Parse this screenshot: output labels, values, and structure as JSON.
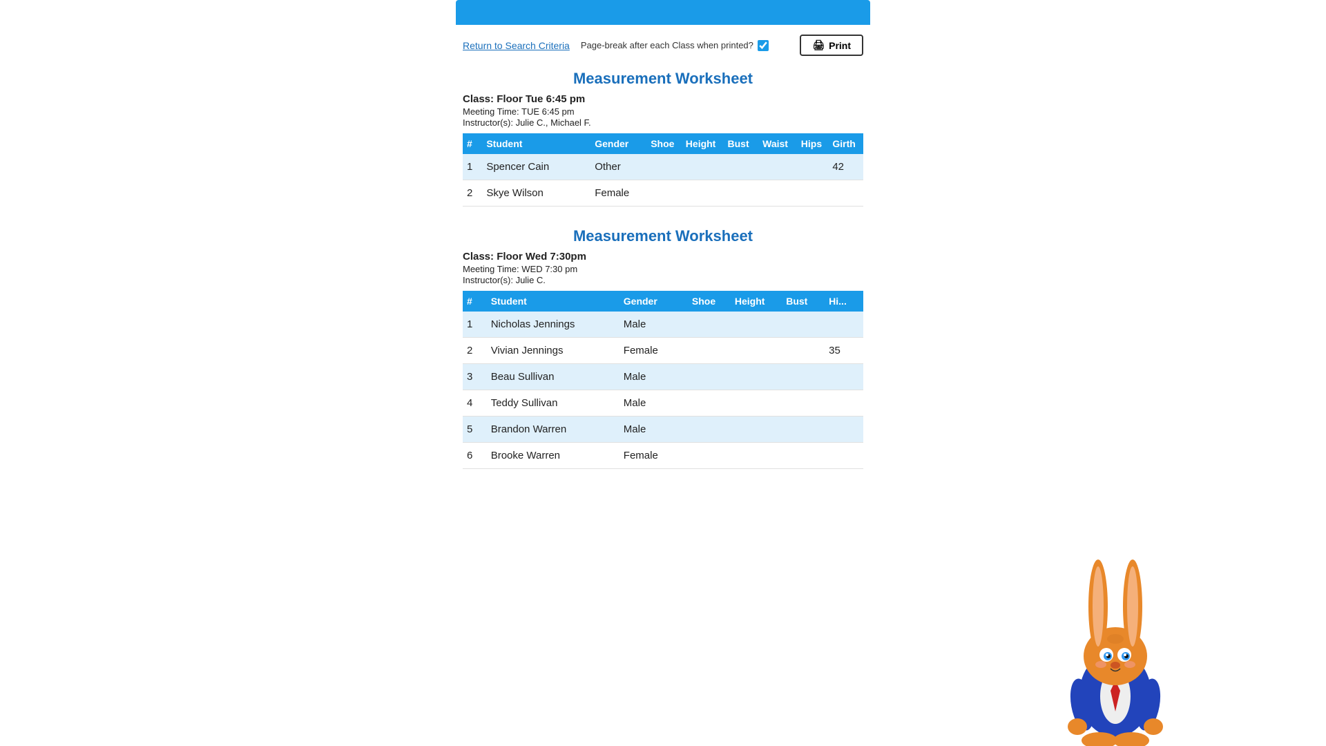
{
  "topbar": {},
  "toolbar": {
    "return_link": "Return to Search Criteria",
    "page_break_label": "Page-break after each Class when printed?",
    "print_label": "Print",
    "checkbox_checked": true
  },
  "section1": {
    "title": "Measurement Worksheet",
    "class_title": "Class: Floor Tue 6:45 pm",
    "meeting_time": "Meeting Time: TUE 6:45 pm",
    "instructors": "Instructor(s): Julie C., Michael F.",
    "table": {
      "headers": [
        "#",
        "Student",
        "Gender",
        "Shoe",
        "Height",
        "Bust",
        "Waist",
        "Hips",
        "Girth"
      ],
      "rows": [
        {
          "num": "1",
          "student": "Spencer Cain",
          "gender": "Other",
          "shoe": "",
          "height": "",
          "bust": "",
          "waist": "",
          "hips": "",
          "girth": "42"
        },
        {
          "num": "2",
          "student": "Skye Wilson",
          "gender": "Female",
          "shoe": "",
          "height": "",
          "bust": "",
          "waist": "",
          "hips": "",
          "girth": ""
        }
      ]
    }
  },
  "section2": {
    "title": "Measurement Worksheet",
    "class_title": "Class: Floor Wed 7:30pm",
    "meeting_time": "Meeting Time: WED 7:30 pm",
    "instructors": "Instructor(s): Julie C.",
    "table": {
      "headers": [
        "#",
        "Student",
        "Gender",
        "Shoe",
        "Height",
        "Bust",
        "Hi..."
      ],
      "rows": [
        {
          "num": "1",
          "student": "Nicholas Jennings",
          "gender": "Male",
          "shoe": "",
          "height": "",
          "bust": "",
          "hips": "",
          "girth": ""
        },
        {
          "num": "2",
          "student": "Vivian Jennings",
          "gender": "Female",
          "shoe": "",
          "height": "",
          "bust": "",
          "hips": "",
          "girth": "35"
        },
        {
          "num": "3",
          "student": "Beau Sullivan",
          "gender": "Male",
          "shoe": "",
          "height": "",
          "bust": "",
          "hips": "",
          "girth": ""
        },
        {
          "num": "4",
          "student": "Teddy Sullivan",
          "gender": "Male",
          "shoe": "",
          "height": "",
          "bust": "",
          "hips": "",
          "girth": ""
        },
        {
          "num": "5",
          "student": "Brandon Warren",
          "gender": "Male",
          "shoe": "",
          "height": "",
          "bust": "",
          "hips": "",
          "girth": ""
        },
        {
          "num": "6",
          "student": "Brooke Warren",
          "gender": "Female",
          "shoe": "",
          "height": "",
          "bust": "",
          "hips": "",
          "girth": ""
        }
      ]
    }
  }
}
